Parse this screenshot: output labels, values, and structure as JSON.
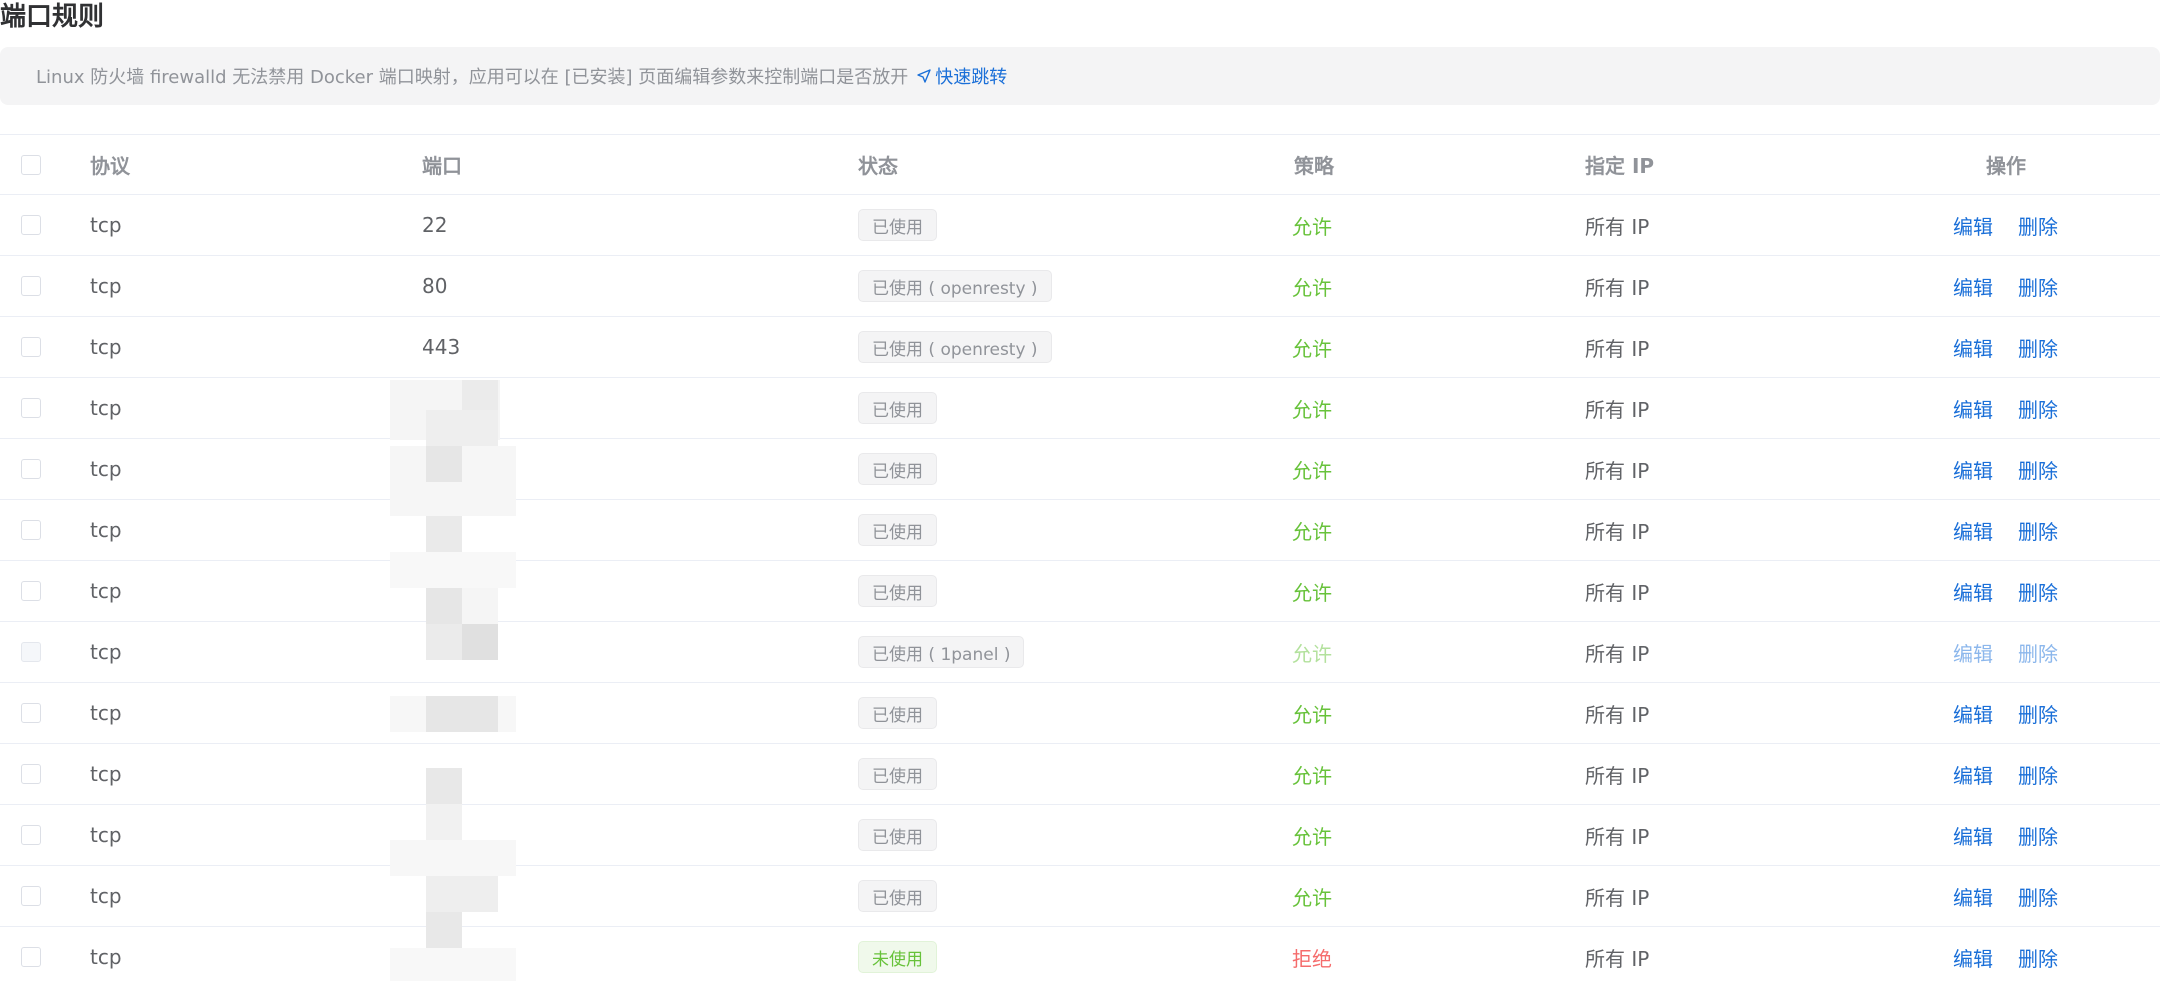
{
  "page_title": "端口规则",
  "notice": {
    "text": "Linux 防火墙 firewalld 无法禁用 Docker 端口映射，应用可以在 [已安装] 页面编辑参数来控制端口是否放开",
    "link_label": "快速跳转"
  },
  "table": {
    "headers": {
      "protocol": "协议",
      "port": "端口",
      "status": "状态",
      "strategy": "策略",
      "ip": "指定 IP",
      "operations": "操作"
    },
    "rows": [
      {
        "protocol": "tcp",
        "port": "22",
        "status": "已使用",
        "strategy": "允许",
        "ip": "所有 IP",
        "edit": "编辑",
        "delete": "删除"
      },
      {
        "protocol": "tcp",
        "port": "80",
        "status": "已使用 ( openresty )",
        "strategy": "允许",
        "ip": "所有 IP",
        "edit": "编辑",
        "delete": "删除"
      },
      {
        "protocol": "tcp",
        "port": "443",
        "status": "已使用 ( openresty )",
        "strategy": "允许",
        "ip": "所有 IP",
        "edit": "编辑",
        "delete": "删除"
      },
      {
        "protocol": "tcp",
        "port": "",
        "status": "已使用",
        "strategy": "允许",
        "ip": "所有 IP",
        "edit": "编辑",
        "delete": "删除"
      },
      {
        "protocol": "tcp",
        "port": "",
        "status": "已使用",
        "strategy": "允许",
        "ip": "所有 IP",
        "edit": "编辑",
        "delete": "删除"
      },
      {
        "protocol": "tcp",
        "port": "",
        "status": "已使用",
        "strategy": "允许",
        "ip": "所有 IP",
        "edit": "编辑",
        "delete": "删除"
      },
      {
        "protocol": "tcp",
        "port": "",
        "status": "已使用",
        "strategy": "允许",
        "ip": "所有 IP",
        "edit": "编辑",
        "delete": "删除"
      },
      {
        "protocol": "tcp",
        "port": "",
        "status": "已使用 ( 1panel )",
        "strategy": "允许",
        "ip": "所有 IP",
        "edit": "编辑",
        "delete": "删除",
        "disabled": true
      },
      {
        "protocol": "tcp",
        "port": "",
        "status": "已使用",
        "strategy": "允许",
        "ip": "所有 IP",
        "edit": "编辑",
        "delete": "删除"
      },
      {
        "protocol": "tcp",
        "port": "",
        "status": "已使用",
        "strategy": "允许",
        "ip": "所有 IP",
        "edit": "编辑",
        "delete": "删除"
      },
      {
        "protocol": "tcp",
        "port": "",
        "status": "已使用",
        "strategy": "允许",
        "ip": "所有 IP",
        "edit": "编辑",
        "delete": "删除"
      },
      {
        "protocol": "tcp",
        "port": "",
        "status": "已使用",
        "strategy": "允许",
        "ip": "所有 IP",
        "edit": "编辑",
        "delete": "删除"
      },
      {
        "protocol": "tcp",
        "port": "",
        "status": "未使用",
        "strategy": "拒绝",
        "ip": "所有 IP",
        "edit": "编辑",
        "delete": "删除",
        "unused": true
      }
    ]
  },
  "colors": {
    "link": "#1a6fd8",
    "allow": "#67c23a",
    "deny": "#f56c6c"
  }
}
